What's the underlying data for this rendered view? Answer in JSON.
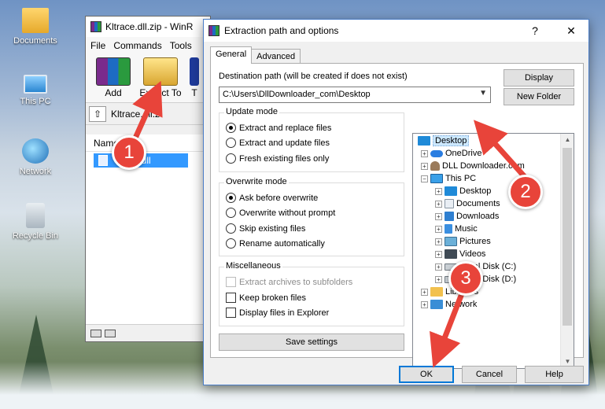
{
  "desktop": {
    "icons": [
      {
        "label": "Documents",
        "icon": "folder-icon"
      },
      {
        "label": "This PC",
        "icon": "computer-icon"
      },
      {
        "label": "Network",
        "icon": "network-icon"
      },
      {
        "label": "Recycle Bin",
        "icon": "recycle-bin-icon"
      }
    ]
  },
  "winrar": {
    "title": "Kltrace.dll.zip - WinR",
    "menu": [
      "File",
      "Commands",
      "Tools"
    ],
    "toolbar": {
      "add": "Add",
      "extract": "Extract To",
      "test": "T"
    },
    "address": "Kltrace.dll.z",
    "column_name": "Name",
    "file": "...ace.dll"
  },
  "dialog": {
    "title": "Extraction path and options",
    "help_glyph": "?",
    "close_glyph": "✕",
    "tabs": {
      "general": "General",
      "advanced": "Advanced"
    },
    "dest_label": "Destination path (will be created if does not exist)",
    "dest_value": "C:\\Users\\DllDownloader_com\\Desktop",
    "display_button": "Display",
    "new_folder_button": "New Folder",
    "update_mode": {
      "title": "Update mode",
      "options": [
        "Extract and replace files",
        "Extract and update files",
        "Fresh existing files only"
      ],
      "selected": 0
    },
    "overwrite_mode": {
      "title": "Overwrite mode",
      "options": [
        "Ask before overwrite",
        "Overwrite without prompt",
        "Skip existing files",
        "Rename automatically"
      ],
      "selected": 0
    },
    "misc": {
      "title": "Miscellaneous",
      "options": [
        "Extract archives to subfolders",
        "Keep broken files",
        "Display files in Explorer"
      ],
      "disabled": [
        true,
        false,
        false
      ],
      "checked": [
        false,
        false,
        false
      ]
    },
    "save_settings_button": "Save settings",
    "tree": [
      {
        "label": "Desktop",
        "selected": true
      },
      {
        "label": "OneDrive"
      },
      {
        "label": "DLL Downloader.com"
      },
      {
        "label": "This PC"
      },
      {
        "label": "Desktop"
      },
      {
        "label": "Documents"
      },
      {
        "label": "Downloads"
      },
      {
        "label": "Music"
      },
      {
        "label": "Pictures"
      },
      {
        "label": "Videos"
      },
      {
        "label": "Local Disk (C:)"
      },
      {
        "label": "Local Disk (D:)"
      },
      {
        "label": "Libraries"
      },
      {
        "label": "Network"
      }
    ],
    "ok_button": "OK",
    "cancel_button": "Cancel",
    "help_button": "Help"
  },
  "annotations": [
    "1",
    "2",
    "3"
  ],
  "colors": {
    "annotation": "#e8443a",
    "selection": "#3399ff",
    "focus": "#0078d7"
  }
}
